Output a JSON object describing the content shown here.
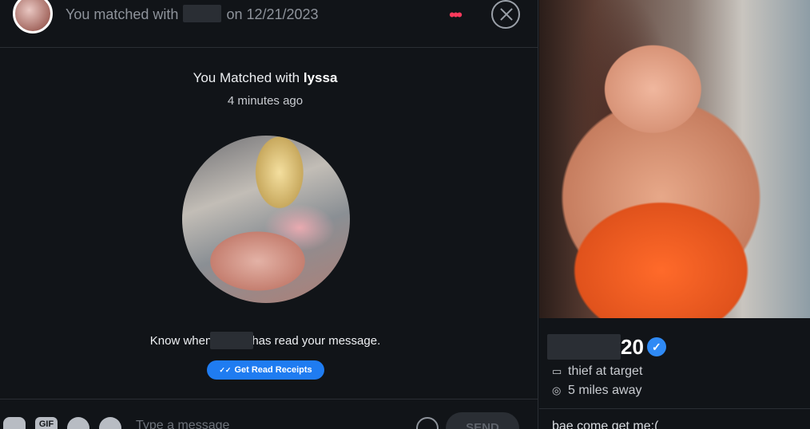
{
  "header": {
    "title_prefix": "You matched with",
    "title_suffix": "on 12/21/2023",
    "more_icon": "•••"
  },
  "match": {
    "title_prefix": "You Matched with",
    "name": "lyssa",
    "time": "4 minutes ago"
  },
  "read_receipts": {
    "text_prefix": "Know when",
    "text_suffix": "has read your message.",
    "button_label": "Get Read Receipts",
    "button_icon": "✓✓"
  },
  "composer": {
    "gif_label": "GIF",
    "placeholder": "Type a message",
    "send_label": "SEND"
  },
  "profile": {
    "age": "20",
    "verified_icon": "✓",
    "job": "thief at target",
    "distance": "5 miles away",
    "bio": "bae come get me:("
  },
  "colors": {
    "accent": "#fd3a5c",
    "button_blue": "#1f7cf1",
    "verified_blue": "#2f8af5",
    "background": "#111418"
  }
}
